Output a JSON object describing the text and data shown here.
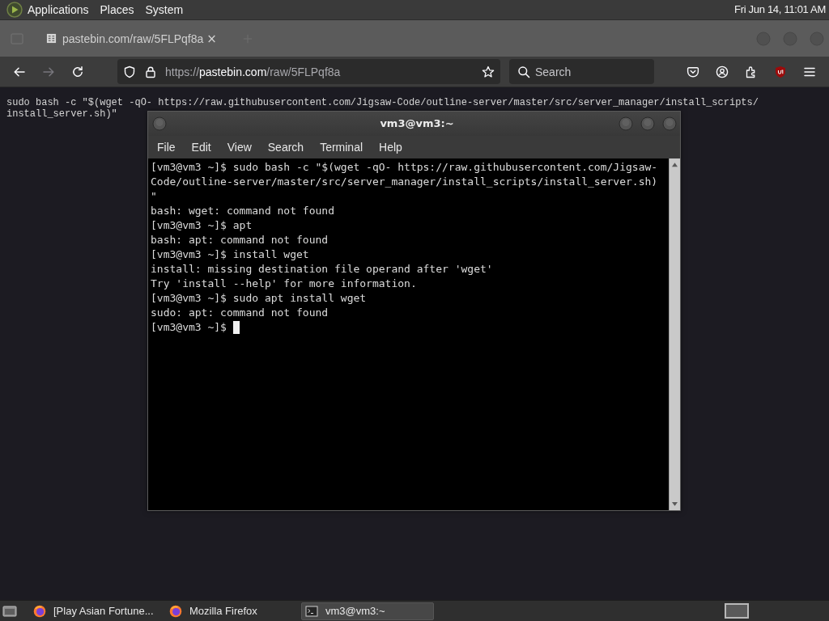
{
  "top_panel": {
    "menus": [
      "Applications",
      "Places",
      "System"
    ],
    "clock": "Fri Jun 14, 11:01 AM"
  },
  "browser": {
    "tab": {
      "title": "pastebin.com/raw/5FLPqf8a",
      "close": "×"
    },
    "toolbar": {
      "forward_disabled": true,
      "url_scheme": "https://",
      "url_host": "pastebin.com",
      "url_path": "/raw/5FLPqf8a",
      "search_placeholder": "Search"
    },
    "page_lines": [
      "sudo bash -c \"$(wget -qO- https://raw.githubusercontent.com/Jigsaw-Code/outline-server/master/src/server_manager/install_scripts/",
      "install_server.sh)\""
    ]
  },
  "terminal": {
    "title": "vm3@vm3:~",
    "menus": [
      "File",
      "Edit",
      "View",
      "Search",
      "Terminal",
      "Help"
    ],
    "lines": [
      "[vm3@vm3 ~]$ sudo bash -c \"$(wget -qO- https://raw.githubusercontent.com/Jigsaw-",
      "Code/outline-server/master/src/server_manager/install_scripts/install_server.sh)",
      "\"",
      "bash: wget: command not found",
      "[vm3@vm3 ~]$ apt",
      "bash: apt: command not found",
      "[vm3@vm3 ~]$ install wget",
      "install: missing destination file operand after 'wget'",
      "Try 'install --help' for more information.",
      "[vm3@vm3 ~]$ sudo apt install wget",
      "sudo: apt: command not found",
      "[vm3@vm3 ~]$"
    ],
    "cursor": true
  },
  "taskbar": {
    "tasks": [
      {
        "kind": "firefox",
        "label": "[Play Asian Fortune...",
        "selected": false
      },
      {
        "kind": "firefox",
        "label": "Mozilla Firefox",
        "selected": false
      },
      {
        "kind": "terminal",
        "label": "vm3@vm3:~",
        "selected": true
      }
    ]
  }
}
